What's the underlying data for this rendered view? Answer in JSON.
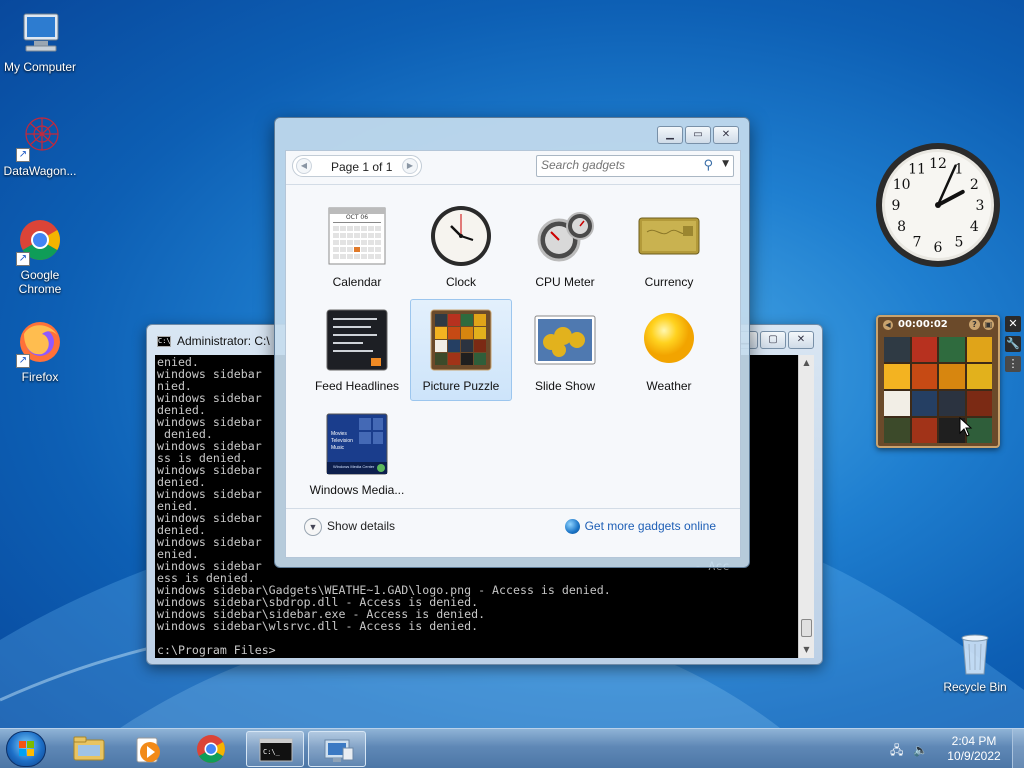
{
  "desktop": {
    "icons": [
      {
        "label": "My Computer"
      },
      {
        "label": "DataWagon..."
      },
      {
        "label": "Google Chrome"
      },
      {
        "label": "Firefox"
      },
      {
        "label": "Recycle Bin"
      }
    ]
  },
  "cmd_window": {
    "title": "Administrator: C:\\",
    "lines": [
      "enied.",
      "windows sidebar                                                              is de",
      "nied.",
      "windows sidebar                                                              ss is",
      "denied.",
      "windows sidebar                                                              ess is",
      " denied.",
      "windows sidebar                                                              - Acce",
      "ss is denied.",
      "windows sidebar                                                              ss is",
      "denied.",
      "windows sidebar                                                              is d",
      "enied.",
      "windows sidebar                                                              ss is",
      "denied.",
      "windows sidebar                                                              is d",
      "enied.",
      "windows sidebar                                                              - Acc",
      "ess is denied.",
      "windows sidebar\\Gadgets\\WEATHE~1.GAD\\logo.png - Access is denied.",
      "windows sidebar\\sbdrop.dll - Access is denied.",
      "windows sidebar\\sidebar.exe - Access is denied.",
      "windows sidebar\\wlsrvc.dll - Access is denied.",
      "",
      "c:\\Program Files>"
    ]
  },
  "gallery": {
    "page_label": "Page 1 of 1",
    "search_placeholder": "Search gadgets",
    "gadgets": [
      {
        "label": "Calendar"
      },
      {
        "label": "Clock"
      },
      {
        "label": "CPU Meter"
      },
      {
        "label": "Currency"
      },
      {
        "label": "Feed Headlines"
      },
      {
        "label": "Picture Puzzle"
      },
      {
        "label": "Slide Show"
      },
      {
        "label": "Weather"
      },
      {
        "label": "Windows Media..."
      }
    ],
    "selected": "Picture Puzzle",
    "show_details": "Show details",
    "get_more": "Get more gadgets online",
    "calendar_month": "OCT 06",
    "media_thumb_lines": [
      "Movies",
      "Television",
      "Music"
    ],
    "media_thumb_caption": "Windows Media Center"
  },
  "clock_gadget": {
    "hour": 2,
    "minute": 4,
    "numbers": [
      "12",
      "1",
      "2",
      "3",
      "4",
      "5",
      "6",
      "7",
      "8",
      "9",
      "10",
      "11"
    ]
  },
  "puzzle_gadget": {
    "timer": "00:00:02"
  },
  "taskbar": {
    "time": "2:04 PM",
    "date": "10/9/2022"
  },
  "colors": {
    "desktop_bg": "#1f7fd0",
    "link": "#1e5fb6",
    "selection": "#cde4fa"
  }
}
